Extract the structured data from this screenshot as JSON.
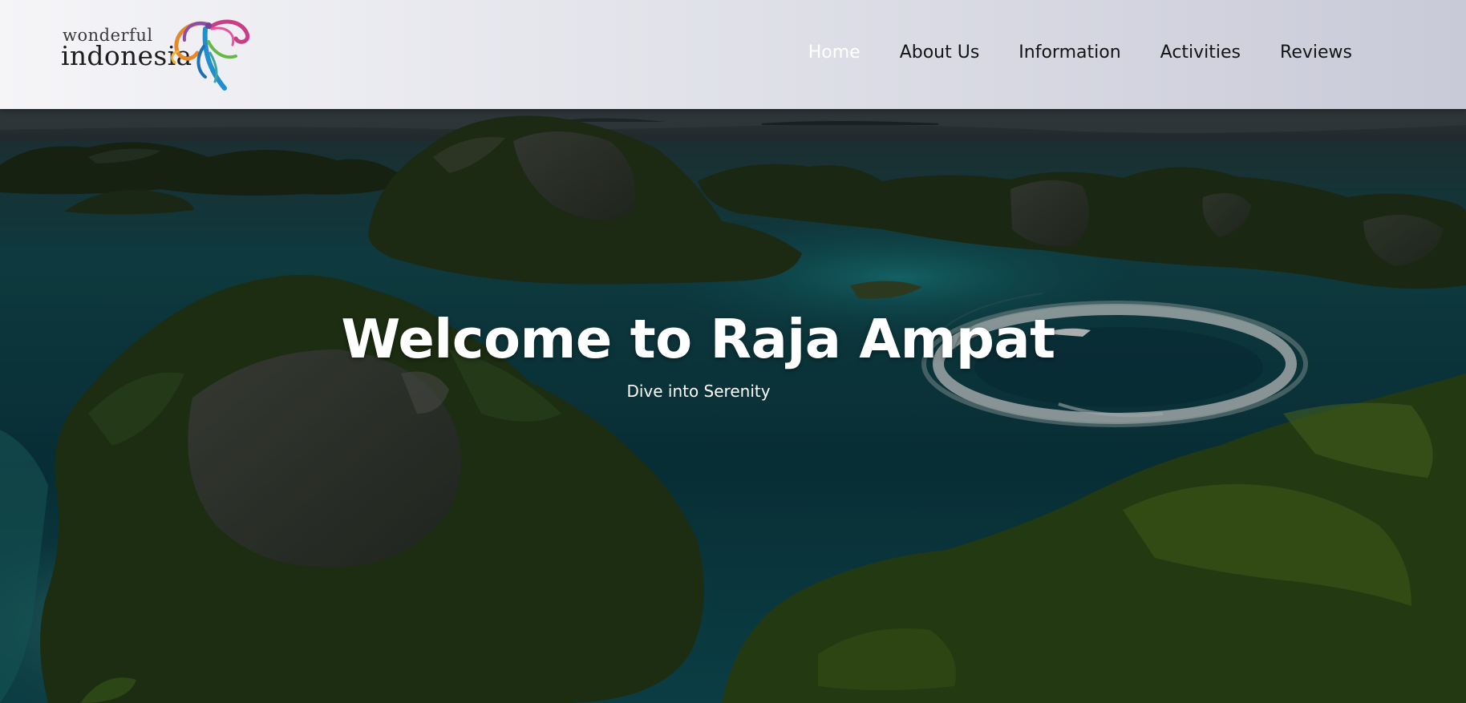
{
  "logo": {
    "line1": "wonderful",
    "line2": "indonesia",
    "icon": "wonderful-indonesia-bird-logo"
  },
  "nav": {
    "items": [
      {
        "label": "Home",
        "active": true
      },
      {
        "label": "About Us",
        "active": false
      },
      {
        "label": "Information",
        "active": false
      },
      {
        "label": "Activities",
        "active": false
      },
      {
        "label": "Reviews",
        "active": false
      }
    ]
  },
  "hero": {
    "title": "Welcome to Raja Ampat",
    "subtitle": "Dive into Serenity",
    "background": "raja-ampat-islands-aerial-photo"
  },
  "colors": {
    "nav_active": "#ffffff",
    "nav_text": "#141414",
    "hero_text": "#ffffff",
    "water": "#0f4e55",
    "foliage": "#2c3f1c"
  }
}
